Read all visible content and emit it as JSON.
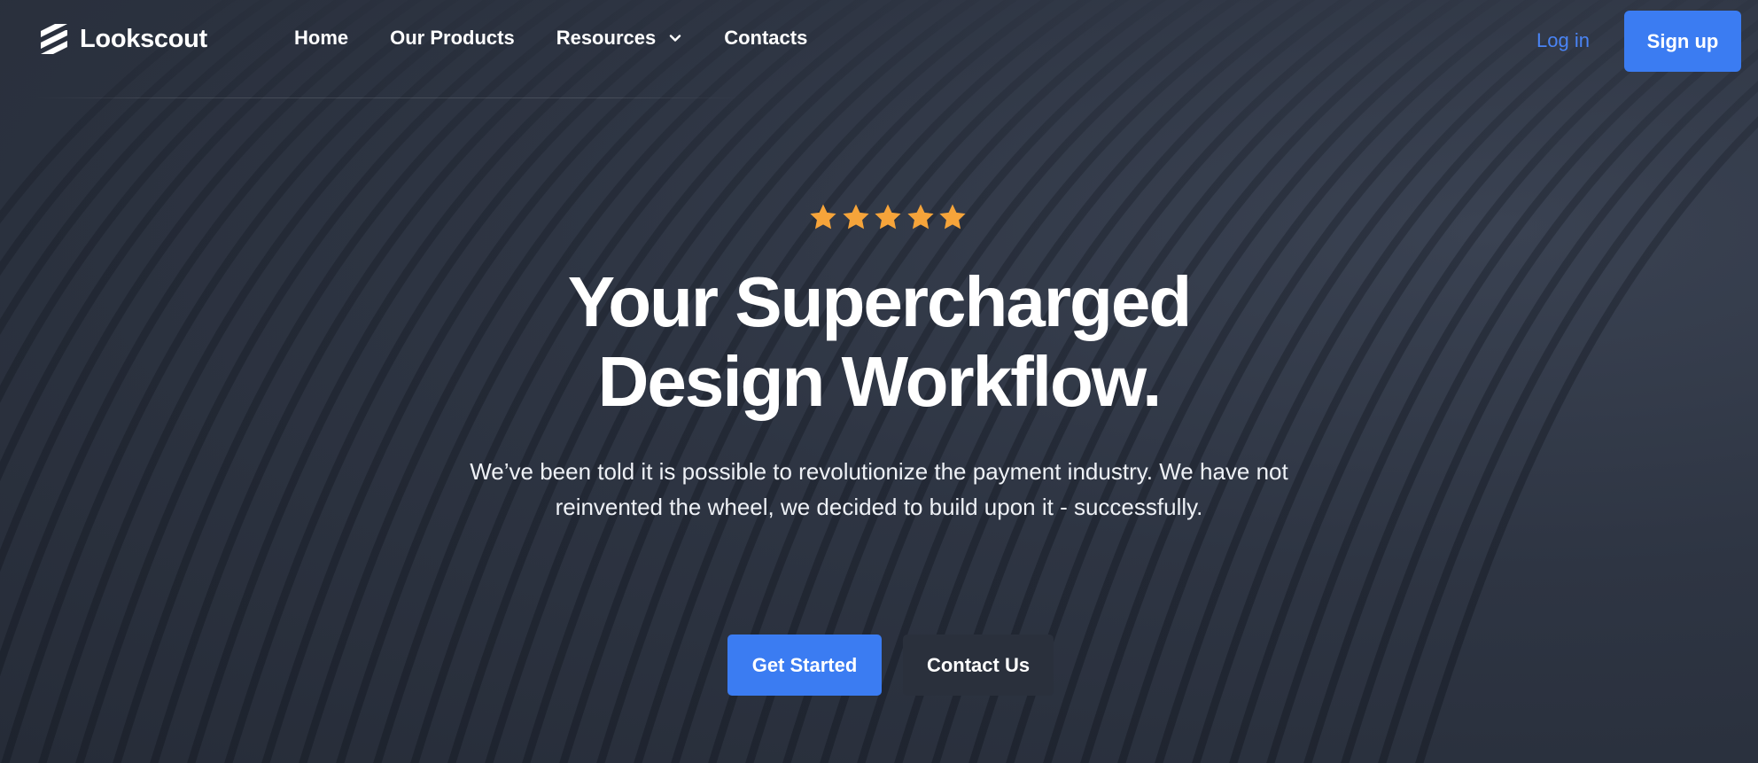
{
  "brand": {
    "name": "Lookscout",
    "logo_icon": "stacked-stripes-logo-icon"
  },
  "nav": {
    "links": [
      {
        "label": "Home"
      },
      {
        "label": "Our Products"
      },
      {
        "label": "Resources",
        "icon": "chevron-down-icon"
      },
      {
        "label": "Contacts"
      }
    ],
    "login_label": "Log in",
    "signup_label": "Sign up"
  },
  "hero": {
    "rating": {
      "value": 5,
      "max": 5,
      "icon": "star-icon",
      "color": "#f6a43a"
    },
    "headline_line1": "Your Supercharged",
    "headline_line2": "Design Workflow.",
    "subtext_line1": "We’ve been told it is possible to revolutionize the payment industry. We have not",
    "subtext_line2": "reinvented the wheel, we decided to build upon it - successfully.",
    "primary_cta": "Get Started",
    "secondary_cta": "Contact Us"
  },
  "colors": {
    "accent": "#3b7cf2",
    "link": "#4a84f5",
    "background": "#2e3543",
    "secondary_button": "#2a303c"
  }
}
